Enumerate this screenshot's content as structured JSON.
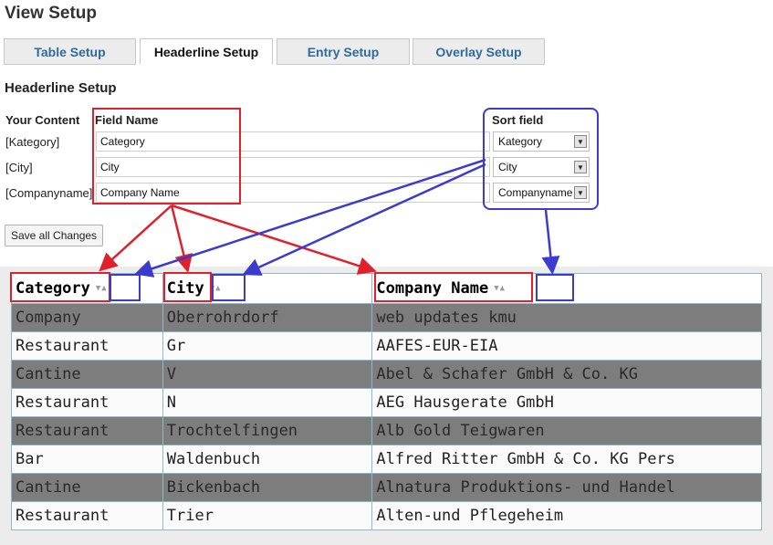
{
  "page": {
    "title": "View Setup"
  },
  "tabs": [
    {
      "label": "Table Setup",
      "active": false
    },
    {
      "label": "Headerline Setup",
      "active": true
    },
    {
      "label": "Entry Setup",
      "active": false
    },
    {
      "label": "Overlay Setup",
      "active": false
    }
  ],
  "section": {
    "title": "Headerline Setup"
  },
  "form": {
    "col_content": "Your Content",
    "col_field": "Field Name",
    "col_sort": "Sort field",
    "rows": [
      {
        "content": "[Kategory]",
        "field": "Category",
        "sort": "Kategory"
      },
      {
        "content": "[City]",
        "field": "City",
        "sort": "City"
      },
      {
        "content": "[Companyname]",
        "field": "Company Name",
        "sort": "Companyname"
      }
    ],
    "save_label": "Save all Changes"
  },
  "table": {
    "headers": [
      "Category",
      "City",
      "Company Name"
    ],
    "sort_glyph": "▼▲",
    "rows": [
      [
        "Company",
        "Oberrohrdorf",
        "web updates kmu"
      ],
      [
        "Restaurant",
        "Gr",
        "AAFES-EUR-EIA"
      ],
      [
        "Cantine",
        "V",
        "Abel & Schafer GmbH & Co. KG"
      ],
      [
        "Restaurant",
        "N",
        "AEG Hausgerate GmbH"
      ],
      [
        "Restaurant",
        "Trochtelfingen",
        "Alb Gold Teigwaren"
      ],
      [
        "Bar",
        "Waldenbuch",
        "Alfred Ritter GmbH & Co. KG Pers"
      ],
      [
        "Cantine",
        "Bickenbach",
        "Alnatura Produktions- und Handel"
      ],
      [
        "Restaurant",
        "Trier",
        "Alten-und Pflegeheim"
      ]
    ]
  },
  "colors": {
    "annotation_red": "#e0202a",
    "annotation_blue": "#3b3bd0",
    "row_dark": "#7d7d7d",
    "tab_text": "#2f6b9e"
  }
}
